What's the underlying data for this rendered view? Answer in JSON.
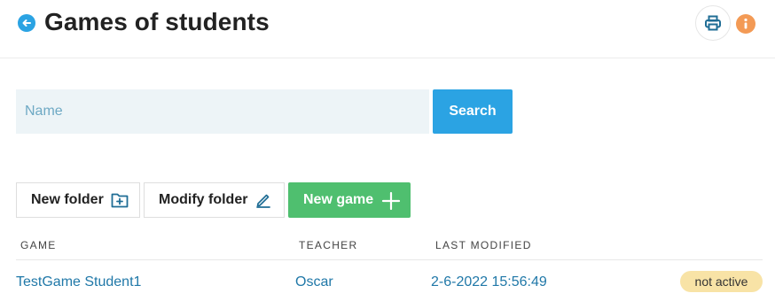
{
  "header": {
    "title": "Games of students",
    "back_icon": "arrow-left-icon",
    "print_icon": "printer-icon",
    "info_icon": "info-icon"
  },
  "search": {
    "placeholder": "Name",
    "value": "",
    "button_label": "Search"
  },
  "toolbar": {
    "new_folder_label": "New folder",
    "new_folder_icon": "folder-plus-icon",
    "modify_folder_label": "Modify folder",
    "modify_folder_icon": "pencil-icon",
    "new_game_label": "New game",
    "new_game_icon": "plus-icon"
  },
  "table": {
    "columns": [
      "GAME",
      "TEACHER",
      "LAST MODIFIED"
    ],
    "rows": [
      {
        "game": "TestGame Student1",
        "teacher": "Oscar",
        "last_modified": "2-6-2022 15:56:49",
        "status": "not active"
      }
    ]
  },
  "colors": {
    "primary": "#2ba3e3",
    "success": "#4fbf6f",
    "info_accent": "#f39a55",
    "badge_bg": "#f8e3a6",
    "link": "#2078a8"
  }
}
